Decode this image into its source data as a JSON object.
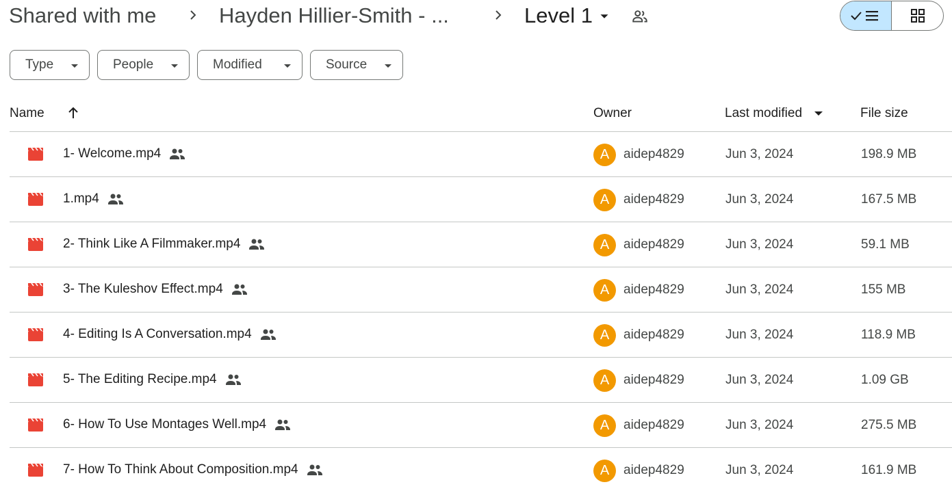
{
  "breadcrumb": {
    "root": "Shared with me",
    "parent": "Hayden Hillier-Smith - ...",
    "current": "Level 1"
  },
  "icons": {
    "separator": "chevron-right-icon",
    "current_menu": "arrow-drop-down-icon",
    "shared_folder": "people-outline-icon",
    "list_view": "check-list-icon",
    "grid_view": "grid-icon",
    "file": "video-file-icon",
    "shared": "people-icon",
    "sort": "arrow-up-icon"
  },
  "filters": [
    {
      "label": "Type"
    },
    {
      "label": "People"
    },
    {
      "label": "Modified"
    },
    {
      "label": "Source"
    }
  ],
  "table": {
    "columns": {
      "name": "Name",
      "owner": "Owner",
      "modified": "Last modified",
      "size": "File size"
    },
    "rows": [
      {
        "name": "1- Welcome.mp4",
        "avatar": "A",
        "owner": "aidep4829",
        "modified": "Jun 3, 2024",
        "size": "198.9 MB"
      },
      {
        "name": "1.mp4",
        "avatar": "A",
        "owner": "aidep4829",
        "modified": "Jun 3, 2024",
        "size": "167.5 MB"
      },
      {
        "name": "2- Think Like A Filmmaker.mp4",
        "avatar": "A",
        "owner": "aidep4829",
        "modified": "Jun 3, 2024",
        "size": "59.1 MB"
      },
      {
        "name": "3- The Kuleshov Effect.mp4",
        "avatar": "A",
        "owner": "aidep4829",
        "modified": "Jun 3, 2024",
        "size": "155 MB"
      },
      {
        "name": "4- Editing Is A Conversation.mp4",
        "avatar": "A",
        "owner": "aidep4829",
        "modified": "Jun 3, 2024",
        "size": "118.9 MB"
      },
      {
        "name": "5- The Editing Recipe.mp4",
        "avatar": "A",
        "owner": "aidep4829",
        "modified": "Jun 3, 2024",
        "size": "1.09 GB"
      },
      {
        "name": "6- How To Use Montages Well.mp4",
        "avatar": "A",
        "owner": "aidep4829",
        "modified": "Jun 3, 2024",
        "size": "275.5 MB"
      },
      {
        "name": "7- How To Think About Composition.mp4",
        "avatar": "A",
        "owner": "aidep4829",
        "modified": "Jun 3, 2024",
        "size": "161.9 MB"
      }
    ]
  },
  "colors": {
    "file_icon": "#ea4335",
    "avatar": "#f29900",
    "selected_view": "#c2e7ff"
  }
}
